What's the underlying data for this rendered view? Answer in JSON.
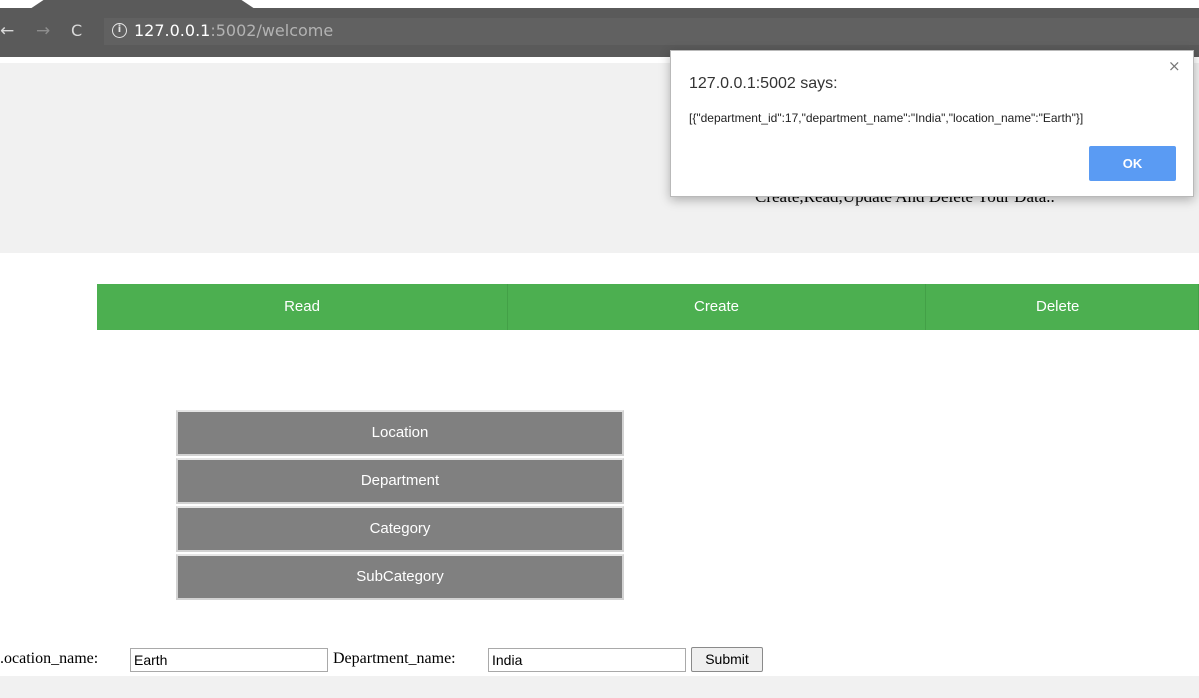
{
  "browser": {
    "url_host": "127.0.0.1",
    "url_path": ":5002/welcome",
    "icons": {
      "back": "arrow-left-icon",
      "forward": "arrow-right-icon",
      "reload": "reload-icon",
      "info": "info-icon"
    }
  },
  "page": {
    "tagline": "Create,Read,Update And Delete Your Data..",
    "nav": {
      "read": "Read",
      "create": "Create",
      "delete": "Delete"
    },
    "menu": [
      "Location",
      "Department",
      "Category",
      "SubCategory"
    ],
    "form": {
      "location_label": ".ocation_name:",
      "location_value": "Earth",
      "department_label": "Department_name:",
      "department_value": "India",
      "submit_label": "Submit"
    }
  },
  "dialog": {
    "title": "127.0.0.1:5002 says:",
    "message": "[{\"department_id\":17,\"department_name\":\"India\",\"location_name\":\"Earth\"}]",
    "ok_label": "OK",
    "close_glyph": "×"
  },
  "colors": {
    "nav_green": "#4caf50",
    "menu_gray": "#808080",
    "ok_blue": "#5a9bf3",
    "chrome": "#5a5a5a"
  }
}
